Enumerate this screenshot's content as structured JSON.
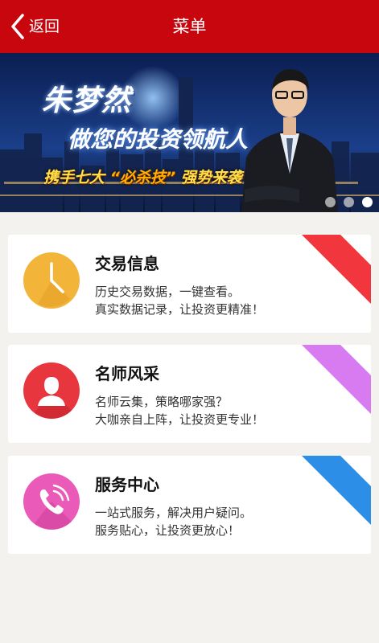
{
  "header": {
    "back_label": "返回",
    "title": "菜单",
    "bg_color": "#c8060e"
  },
  "banner": {
    "line1": "朱梦然",
    "line2": "做您的投资领航人",
    "line3_pre": "携手七大",
    "line3_quote": "“必杀技”",
    "line3_post": "强势来袭",
    "slides": 3,
    "active_slide": 3
  },
  "cards": [
    {
      "title": "交易信息",
      "line1": "历史交易数据，一键查看。",
      "line2": "真实数据记录，让投资更精准！",
      "icon": "clock-icon",
      "icon_color": "#f2b53a",
      "ribbon_color": "#f2363d"
    },
    {
      "title": "名师风采",
      "line1": "名师云集，策略哪家强？",
      "line2": "大咖亲自上阵，让投资更专业！",
      "icon": "user-icon",
      "icon_color": "#e8363f",
      "ribbon_color": "#d97bf0"
    },
    {
      "title": "服务中心",
      "line1": "一站式服务，解决用户疑问。",
      "line2": "服务贴心，让投资更放心！",
      "icon": "phone-icon",
      "icon_color": "#ea5ab8",
      "ribbon_color": "#2c8ee6"
    }
  ]
}
